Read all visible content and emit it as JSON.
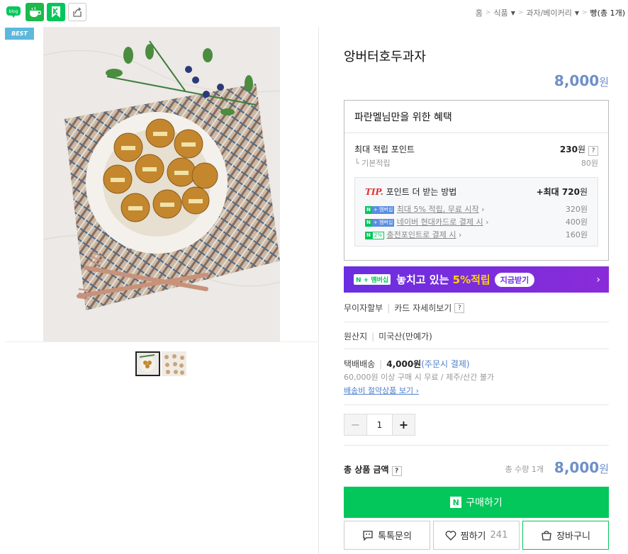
{
  "share": {
    "blog_label": "blog"
  },
  "breadcrumb": {
    "home": "홈",
    "cat1": "식품",
    "cat2": "과자/베이커리",
    "current": "빵(총 1개)"
  },
  "product": {
    "badge": "BEST",
    "title": "앙버터호두과자",
    "price": "8,000",
    "price_unit": "원"
  },
  "benefit": {
    "header": "파란멜님만을 위한 혜택",
    "max_point_label": "최대 적립 포인트",
    "max_point_value": "230",
    "won": "원",
    "help": "?",
    "base_label": "기본적립",
    "base_value": "80원",
    "tip_prefix": "TIP.",
    "tip_title": " 포인트 더 받는 방법",
    "tip_max_prefix": "+최대 ",
    "tip_max_value": "720",
    "tip_max_unit": "원",
    "tips": [
      {
        "badge1": "N",
        "badge2": "+ 멤버십",
        "text": "최대 5% 적립, 무료 시작",
        "value": "320원"
      },
      {
        "badge1": "N",
        "badge2": "+ 멤버십",
        "text": "네이버 현대카드로 결제 시",
        "value": "400원"
      },
      {
        "badge1": "N",
        "badge2": "2%",
        "text": "충전포인트로 결제 시",
        "value": "160원"
      }
    ]
  },
  "banner": {
    "badge": "N + 멤버십",
    "text_a": "놓치고 있는 ",
    "text_b": "5%적립",
    "button": "지금받기",
    "arrow": "›"
  },
  "installment": {
    "label": "무이자할부",
    "link": "카드 자세히보기",
    "help": "?"
  },
  "origin": {
    "label": "원산지",
    "value": "미국산(만예가)"
  },
  "shipping": {
    "label": "택배배송",
    "fee": "4,000원",
    "note": "(주문시 결제)",
    "condition": "60,000원 이상 구매 시 무료 / 제주/산간 불가",
    "link": "배송비 절약상품 보기 ›"
  },
  "quantity": {
    "minus": "−",
    "value": "1",
    "plus": "+"
  },
  "total": {
    "label": "총 상품 금액",
    "help": "?",
    "qty": "총 수량 1개",
    "price": "8,000",
    "unit": "원"
  },
  "buttons": {
    "buy": "구매하기",
    "buy_logo": "N",
    "talk": "톡톡문의",
    "wish": "찜하기",
    "wish_count": "241",
    "cart": "장바구니"
  },
  "colors": {
    "price_blue": "#6e8fc9",
    "naver_green": "#03c75a",
    "banner_purple": "#6a2ee0",
    "best_badge": "#5db8dc"
  }
}
